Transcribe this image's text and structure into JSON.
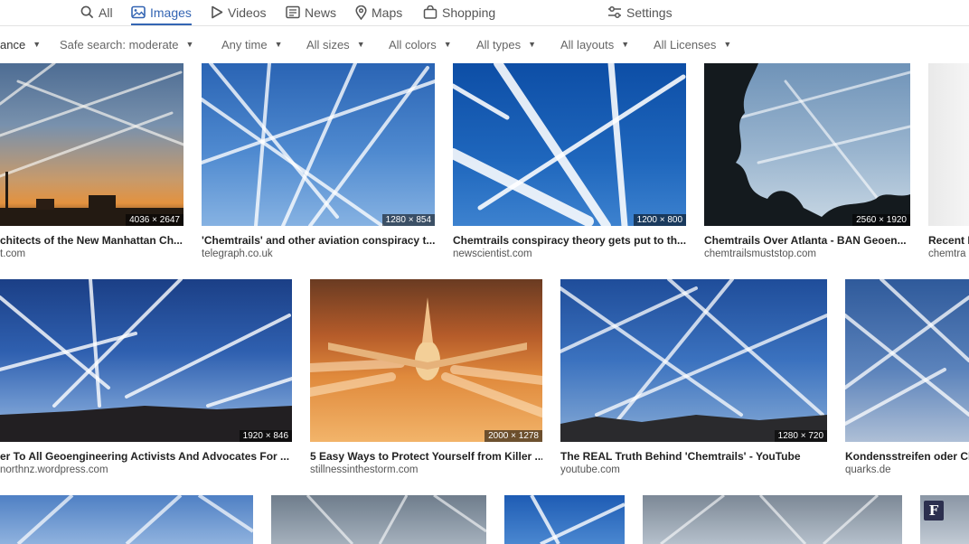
{
  "nav": {
    "tabs": [
      {
        "label": "All",
        "icon": "search-icon"
      },
      {
        "label": "Images",
        "icon": "image-icon",
        "active": true
      },
      {
        "label": "Videos",
        "icon": "play-icon"
      },
      {
        "label": "News",
        "icon": "newspaper-icon"
      },
      {
        "label": "Maps",
        "icon": "map-pin-icon"
      },
      {
        "label": "Shopping",
        "icon": "shopping-bag-icon"
      }
    ],
    "settings_label": "Settings"
  },
  "filters": [
    "ance",
    "Safe search: moderate",
    "Any time",
    "All sizes",
    "All colors",
    "All types",
    "All layouts",
    "All Licenses"
  ],
  "results": [
    {
      "title": "chitects of the New Manhattan Ch...",
      "source": "t.com",
      "dims": "4036 × 2647"
    },
    {
      "title": "'Chemtrails' and other aviation conspiracy t...",
      "source": "telegraph.co.uk",
      "dims": "1280 × 854"
    },
    {
      "title": "Chemtrails conspiracy theory gets put to th...",
      "source": "newscientist.com",
      "dims": "1200 × 800"
    },
    {
      "title": "Chemtrails Over Atlanta - BAN Geoen...",
      "source": "chemtrailsmuststop.com",
      "dims": "2560 × 1920"
    },
    {
      "title": "Recent I",
      "source": "chemtra",
      "dims": ""
    },
    {
      "title": "er To All Geoengineering Activists And Advocates For ...",
      "source": "northnz.wordpress.com",
      "dims": "1920 × 846"
    },
    {
      "title": "5 Easy Ways to Protect Yourself from Killer ...",
      "source": "stillnessinthestorm.com",
      "dims": "2000 × 1278"
    },
    {
      "title": "The REAL Truth Behind 'Chemtrails' - YouTube",
      "source": "youtube.com",
      "dims": "1280 × 720"
    },
    {
      "title": "Kondensstreifen oder Ch",
      "source": "quarks.de",
      "dims": ""
    }
  ],
  "colors": {
    "accent": "#3465b3"
  }
}
